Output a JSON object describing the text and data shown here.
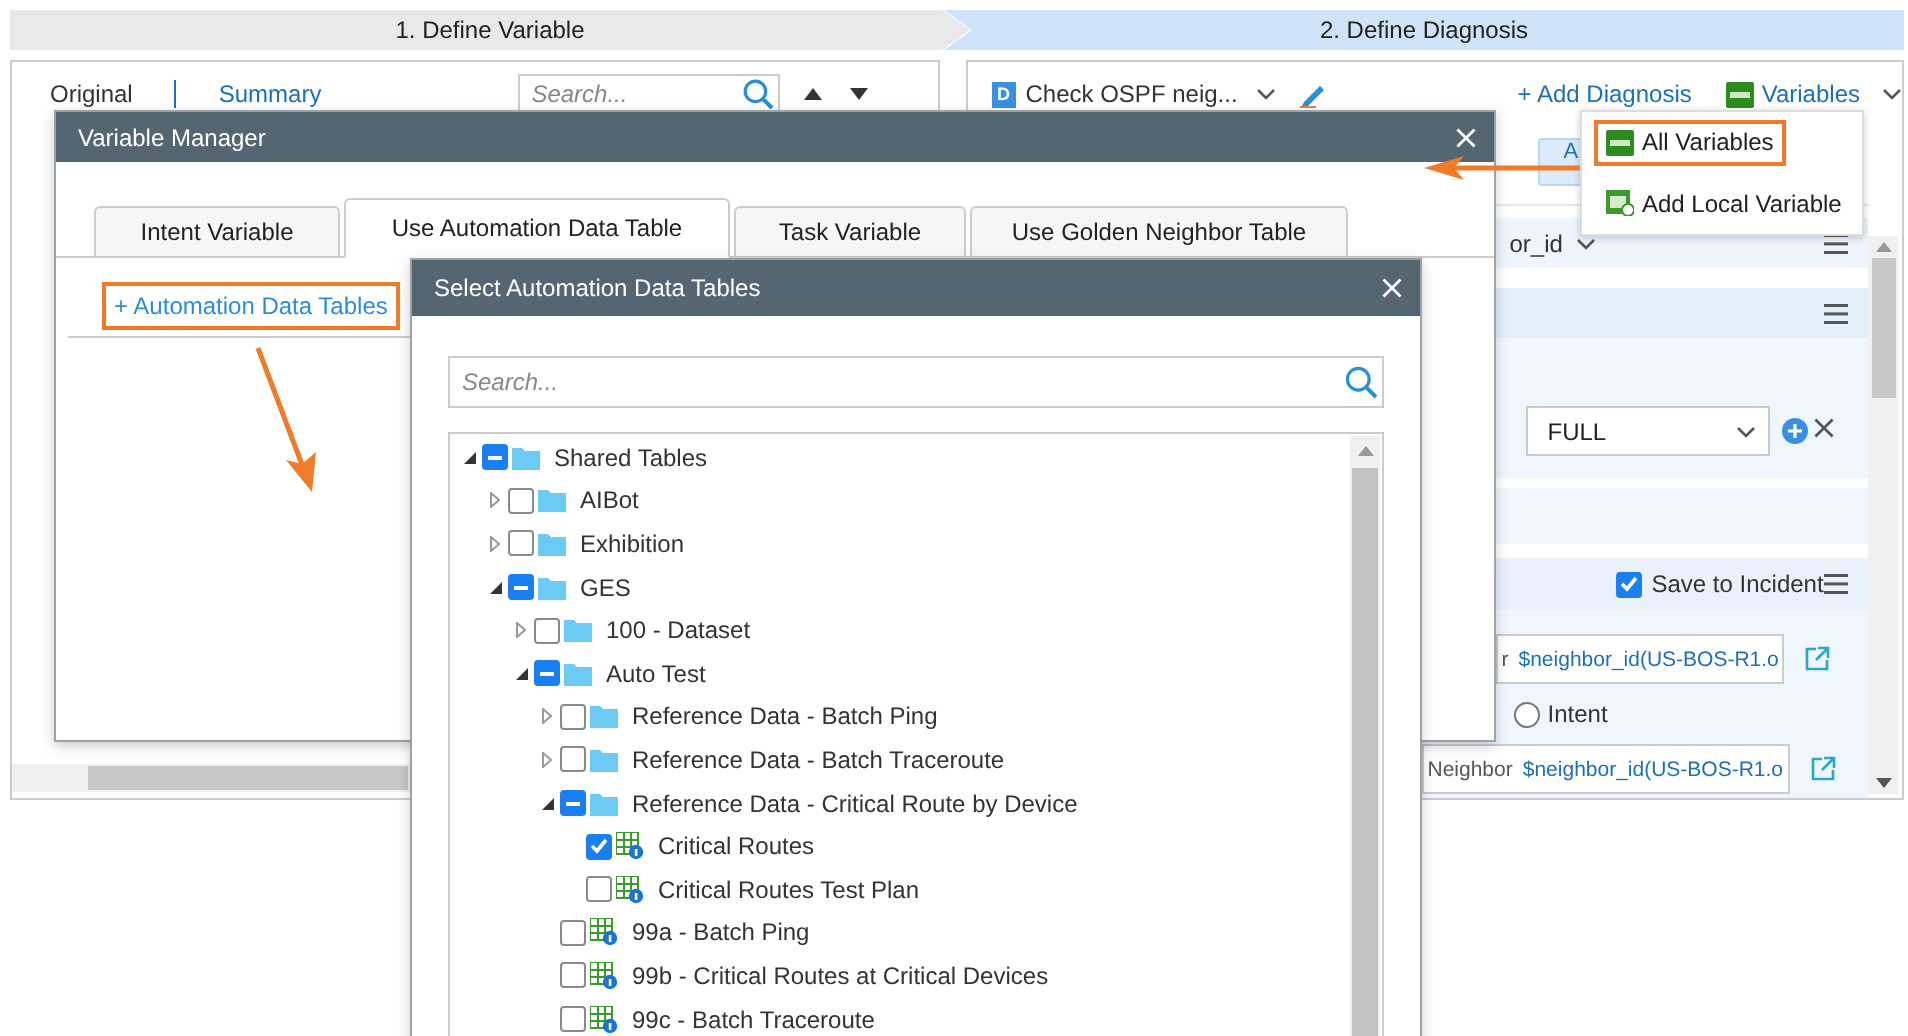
{
  "steps": [
    {
      "label": "1. Define Variable",
      "selected": false
    },
    {
      "label": "2. Define Diagnosis",
      "selected": true
    }
  ],
  "left_panel": {
    "tabs": [
      {
        "label": "Original",
        "selected": true
      },
      {
        "label": "Summary",
        "selected": false
      }
    ],
    "search": {
      "placeholder": "Search..."
    }
  },
  "right_panel": {
    "diagnosis": {
      "badge": "D",
      "name": "Check OSPF neig..."
    },
    "add_diagnosis": "+ Add Diagnosis",
    "variables": "Variables",
    "partial_button": "A",
    "partial_column": "or_id",
    "mode": "FULL",
    "save_to_incident": {
      "label": "Save to Incident",
      "checked": true
    },
    "fields": [
      {
        "prefix": "r",
        "value": "$neighbor_id(US-BOS-R1.o"
      },
      {
        "prefix": "Neighbor",
        "value": "$neighbor_id(US-BOS-R1.o"
      }
    ],
    "radio": {
      "label": "Intent",
      "selected": false
    }
  },
  "variables_menu": [
    {
      "label": "All Variables",
      "kind": "all",
      "selected": true
    },
    {
      "label": "Add Local Variable",
      "kind": "local",
      "selected": false
    }
  ],
  "variable_manager": {
    "title": "Variable Manager",
    "tabs": [
      {
        "label": "Intent Variable",
        "selected": false
      },
      {
        "label": "Use Automation Data Table",
        "selected": true
      },
      {
        "label": "Task Variable",
        "selected": false
      },
      {
        "label": "Use Golden Neighbor Table",
        "selected": false
      }
    ],
    "add_link": "+ Automation Data Tables"
  },
  "select_dialog": {
    "title": "Select Automation Data Tables",
    "search": {
      "placeholder": "Search..."
    },
    "tree": [
      {
        "label": "Shared Tables",
        "kind": "folder",
        "expanded": true,
        "checked": false,
        "partial": true,
        "children": [
          {
            "label": "AIBot",
            "kind": "folder",
            "expanded": false,
            "checked": false,
            "partial": false
          },
          {
            "label": "Exhibition",
            "kind": "folder",
            "expanded": false,
            "checked": false,
            "partial": false
          },
          {
            "label": "GES",
            "kind": "folder",
            "expanded": true,
            "checked": false,
            "partial": true,
            "children": [
              {
                "label": "100 - Dataset",
                "kind": "folder",
                "expanded": false,
                "checked": false,
                "partial": false
              },
              {
                "label": "Auto Test",
                "kind": "folder",
                "expanded": true,
                "checked": false,
                "partial": true,
                "children": [
                  {
                    "label": "Reference Data - Batch Ping",
                    "kind": "folder",
                    "expanded": false,
                    "checked": false,
                    "partial": false
                  },
                  {
                    "label": "Reference Data - Batch Traceroute",
                    "kind": "folder",
                    "expanded": false,
                    "checked": false,
                    "partial": false
                  },
                  {
                    "label": "Reference Data - Critical Route by Device",
                    "kind": "folder",
                    "expanded": true,
                    "checked": false,
                    "partial": true,
                    "children": [
                      {
                        "label": "Critical Routes",
                        "kind": "table",
                        "checked": true
                      },
                      {
                        "label": "Critical Routes Test Plan",
                        "kind": "table",
                        "checked": false,
                        "partial": false
                      }
                    ]
                  },
                  {
                    "label": "99a - Batch Ping",
                    "kind": "table",
                    "checked": false,
                    "partial": false
                  },
                  {
                    "label": "99b - Critical Routes at Critical Devices",
                    "kind": "table",
                    "checked": false,
                    "partial": false
                  },
                  {
                    "label": "99c - Batch Traceroute",
                    "kind": "table",
                    "checked": false,
                    "partial": false
                  }
                ]
              }
            ]
          }
        ]
      }
    ]
  }
}
